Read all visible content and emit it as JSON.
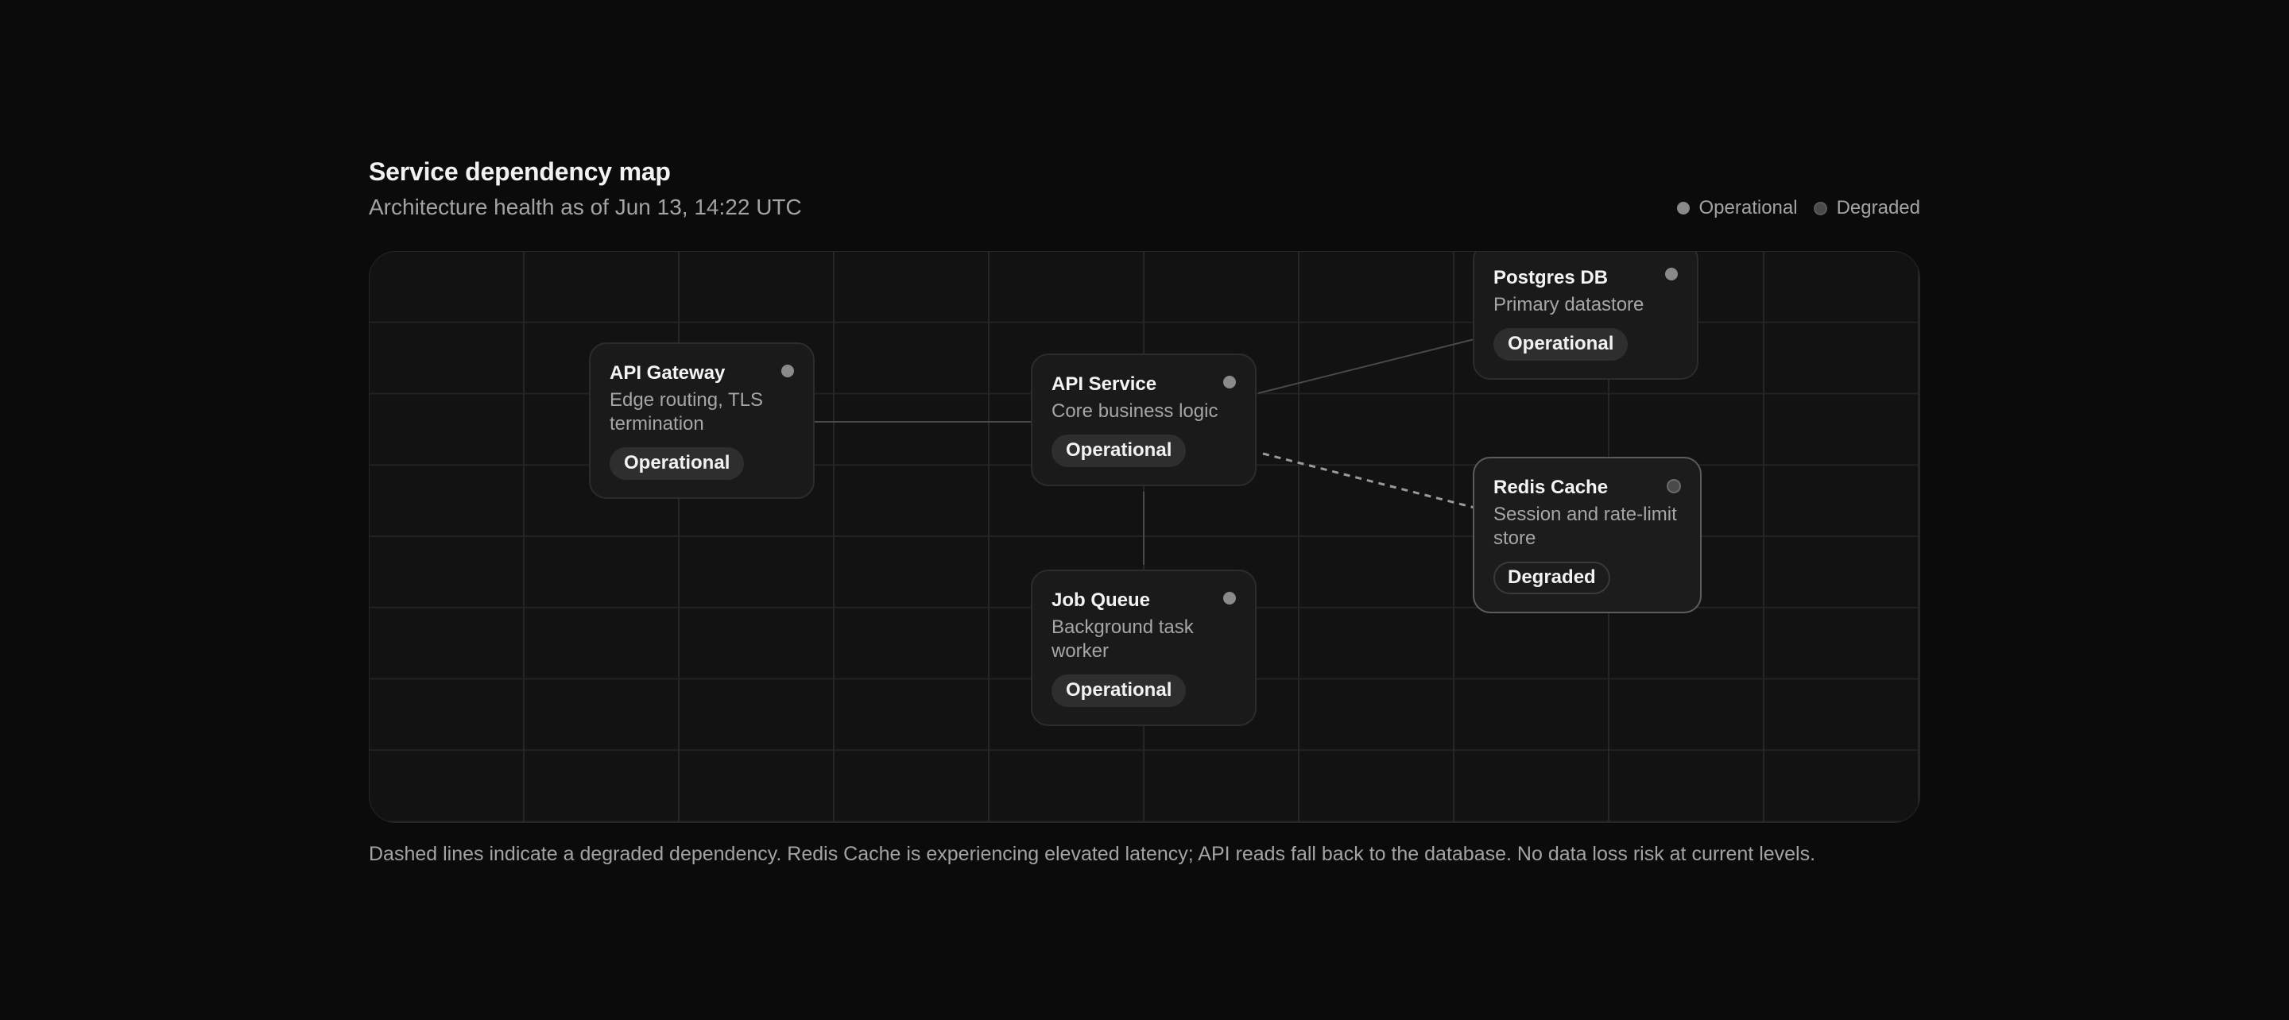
{
  "header": {
    "title": "Service dependency map",
    "subtitle": "Architecture health as of Jun 13, 14:22 UTC"
  },
  "legend": [
    {
      "label": "Operational",
      "color": "#8a8a8a"
    },
    {
      "label": "Degraded",
      "color": "#4a4a4a"
    }
  ],
  "nodes": [
    {
      "id": "api-gateway",
      "name": "API Gateway",
      "description": "Edge routing, TLS termination",
      "status": "Operational"
    },
    {
      "id": "api-service",
      "name": "API Service",
      "description": "Core business logic",
      "status": "Operational"
    },
    {
      "id": "postgres-db",
      "name": "Postgres DB",
      "description": "Primary datastore",
      "status": "Operational"
    },
    {
      "id": "redis-cache",
      "name": "Redis Cache",
      "description": "Session and rate-limit store",
      "status": "Degraded"
    },
    {
      "id": "job-queue",
      "name": "Job Queue",
      "description": "Background task worker",
      "status": "Operational"
    }
  ],
  "edges": [
    {
      "from": "API Gateway",
      "to": "API Service",
      "style": "solid"
    },
    {
      "from": "API Service",
      "to": "Postgres DB",
      "style": "solid"
    },
    {
      "from": "API Service",
      "to": "Redis Cache",
      "style": "dashed"
    },
    {
      "from": "API Service",
      "to": "Job Queue",
      "style": "solid"
    }
  ],
  "colors": {
    "operational_dot": "#8a8a8a",
    "degraded_dot": "#4a4a4a",
    "edge": "#4a4a4a",
    "degraded_edge": "#9a9a9a"
  },
  "footnote": "Dashed lines indicate a degraded dependency. Redis Cache is experiencing elevated latency; API reads fall back to the database. No data loss risk at current levels."
}
